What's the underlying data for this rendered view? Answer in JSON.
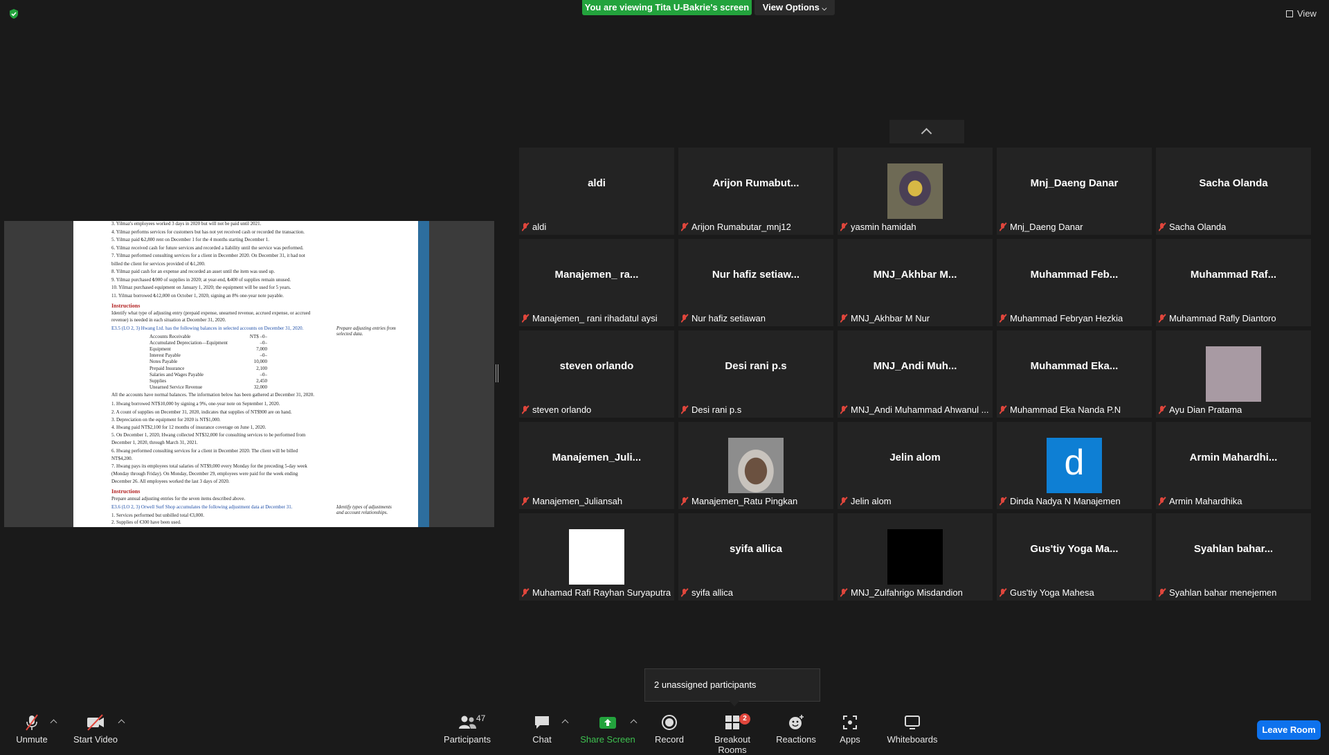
{
  "top": {
    "viewing_banner": "You are viewing Tita U-Bakrie's screen",
    "view_options": "View Options",
    "view_button": "View"
  },
  "shared_doc": {
    "lines": [
      "3.  Yilmaz's employees worked 3 days in 2020 but will not be paid until 2021.",
      "4.  Yilmaz performs services for customers but has not yet received cash or recorded the transaction.",
      "5.  Yilmaz paid ₺2,800 rent on December 1 for the 4 months starting December 1.",
      "6.  Yilmaz received cash for future services and recorded a liability until the service was performed.",
      "7.  Yilmaz performed consulting services for a client in December 2020. On December 31, it had not",
      "     billed the client for services provided of ₺1,200.",
      "8.  Yilmaz paid cash for an expense and recorded an asset until the item was used up.",
      "9.  Yilmaz purchased ₺900 of supplies in 2020; at year-end, ₺400 of supplies remain unused.",
      "10. Yilmaz purchased equipment on January 1, 2020; the equipment will be used for 5 years.",
      "11. Yilmaz borrowed ₺12,000 on October 1, 2020, signing an 8% one-year note payable."
    ],
    "instructions_1": "Instructions",
    "instr_text_1": "Identify what type of adjusting entry (prepaid expense, unearned revenue, accrued expense, or accrued",
    "instr_text_2": "revenue) is needed in each situation at December 31, 2020.",
    "e35": "E3.5 (LO 2, 3)  Hwang Ltd. has the following balances in selected accounts on December 31, 2020.",
    "e35_side": "Prepare adjusting entries from selected data.",
    "accounts": [
      {
        "name": "Accounts Receivable",
        "value": "NT$  –0–"
      },
      {
        "name": "Accumulated Depreciation—Equipment",
        "value": "–0–"
      },
      {
        "name": "Equipment",
        "value": "7,000"
      },
      {
        "name": "Interest Payable",
        "value": "–0–"
      },
      {
        "name": "Notes Payable",
        "value": "10,000"
      },
      {
        "name": "Prepaid Insurance",
        "value": "2,100"
      },
      {
        "name": "Salaries and Wages Payable",
        "value": "–0–"
      },
      {
        "name": "Supplies",
        "value": "2,450"
      },
      {
        "name": "Unearned Service Revenue",
        "value": "32,000"
      }
    ],
    "normal_bal": "All the accounts have normal balances. The information below has been gathered at December 31, 2020.",
    "items": [
      "1.  Hwang borrowed NT$10,000 by signing a 9%, one-year note on September 1, 2020.",
      "2.  A count of supplies on December 31, 2020, indicates that supplies of NT$900 are on hand.",
      "3.  Depreciation on the equipment for 2020 is NT$1,000.",
      "4.  Hwang paid NT$2,100 for 12 months of insurance coverage on June 1, 2020.",
      "5.  On December 1, 2020, Hwang collected NT$32,000 for consulting services to be performed from",
      "     December 1, 2020, through March 31, 2021.",
      "6.  Hwang performed consulting services for a client in December 2020. The client will be billed",
      "     NT$4,200.",
      "7.  Hwang pays its employees total salaries of NT$9,000 every Monday for the preceding 5-day week",
      "     (Monday through Friday). On Monday, December 29, employees were paid for the week ending",
      "     December 26. All employees worked the last 3 days of 2020."
    ],
    "instructions_2": "Instructions",
    "instr_text_3": "Prepare annual adjusting entries for the seven items described above.",
    "e36": "E3.6 (LO 2, 3)  Orwell Surf Shop accumulates the following adjustment data at December 31.",
    "e36_side": "Identify types of adjustments and account relationships.",
    "e36_1": "1.  Services performed but unbilled total €3,000.",
    "e36_2": "2.  Supplies of €300 have been used."
  },
  "tiles": [
    {
      "name": "aldi",
      "label": "aldi"
    },
    {
      "name": "Arijon  Rumabut...",
      "label": "Arijon Rumabutar_mnj12"
    },
    {
      "name": "",
      "label": "yasmin hamidah",
      "pic": "photo",
      "color": "#5b5647"
    },
    {
      "name": "Mnj_Daeng Danar",
      "label": "Mnj_Daeng Danar"
    },
    {
      "name": "Sacha Olanda",
      "label": "Sacha Olanda"
    },
    {
      "name": "Manajemen_  ra...",
      "label": "Manajemen_ rani rihadatul aysi"
    },
    {
      "name": "Nur hafiz setiaw...",
      "label": "Nur hafiz setiawan"
    },
    {
      "name": "MNJ_Akhbar  M...",
      "label": "MNJ_Akhbar M Nur"
    },
    {
      "name": "Muhammad  Feb...",
      "label": "Muhammad Febryan Hezkia"
    },
    {
      "name": "Muhammad  Raf...",
      "label": "Muhammad Rafly Diantoro"
    },
    {
      "name": "steven orlando",
      "label": "steven orlando"
    },
    {
      "name": "Desi rani p.s",
      "label": "Desi rani p.s"
    },
    {
      "name": "MNJ_Andi  Muh...",
      "label": "MNJ_Andi Muhammad Ahwanul ..."
    },
    {
      "name": "Muhammad  Eka...",
      "label": "Muhammad Eka Nanda P.N"
    },
    {
      "name": "",
      "label": "Ayu Dian Pratama",
      "pic": "solid",
      "color": "#a89aa3"
    },
    {
      "name": "Manajemen_Juli...",
      "label": "Manajemen_Juliansah"
    },
    {
      "name": "",
      "label": "Manajemen_Ratu Pingkan",
      "pic": "photo2",
      "color": "#8a7a6a"
    },
    {
      "name": "Jelin alom",
      "label": "Jelin alom"
    },
    {
      "name": "",
      "label": "Dinda Nadya N Manajemen",
      "pic": "letter",
      "letter": "d",
      "color": "#0e7fd4"
    },
    {
      "name": "Armin  Mahardhi...",
      "label": "Armin Mahardhika"
    },
    {
      "name": "",
      "label": "Muhamad Rafi Rayhan Suryaputra",
      "pic": "solid",
      "color": "#ffffff"
    },
    {
      "name": "syifa allica",
      "label": "syifa allica"
    },
    {
      "name": "",
      "label": "MNJ_Zulfahrigo Misdandion",
      "pic": "solid",
      "color": "#000000"
    },
    {
      "name": "Gus'tiy  Yoga  Ma...",
      "label": "Gus'tiy Yoga Mahesa"
    },
    {
      "name": "Syahlan  bahar...",
      "label": "Syahlan bahar menejemen"
    }
  ],
  "popup": "2 unassigned participants",
  "toolbar": {
    "unmute": "Unmute",
    "start_video": "Start Video",
    "participants": "Participants",
    "participants_count": "47",
    "chat": "Chat",
    "share_screen": "Share Screen",
    "record": "Record",
    "breakout_rooms": "Breakout Rooms",
    "breakout_badge": "2",
    "reactions": "Reactions",
    "apps": "Apps",
    "whiteboards": "Whiteboards",
    "leave": "Leave Room"
  },
  "colors": {
    "share_green": "#23a33d",
    "leave_blue": "#0e72ed",
    "mute_red": "#e0463c"
  }
}
